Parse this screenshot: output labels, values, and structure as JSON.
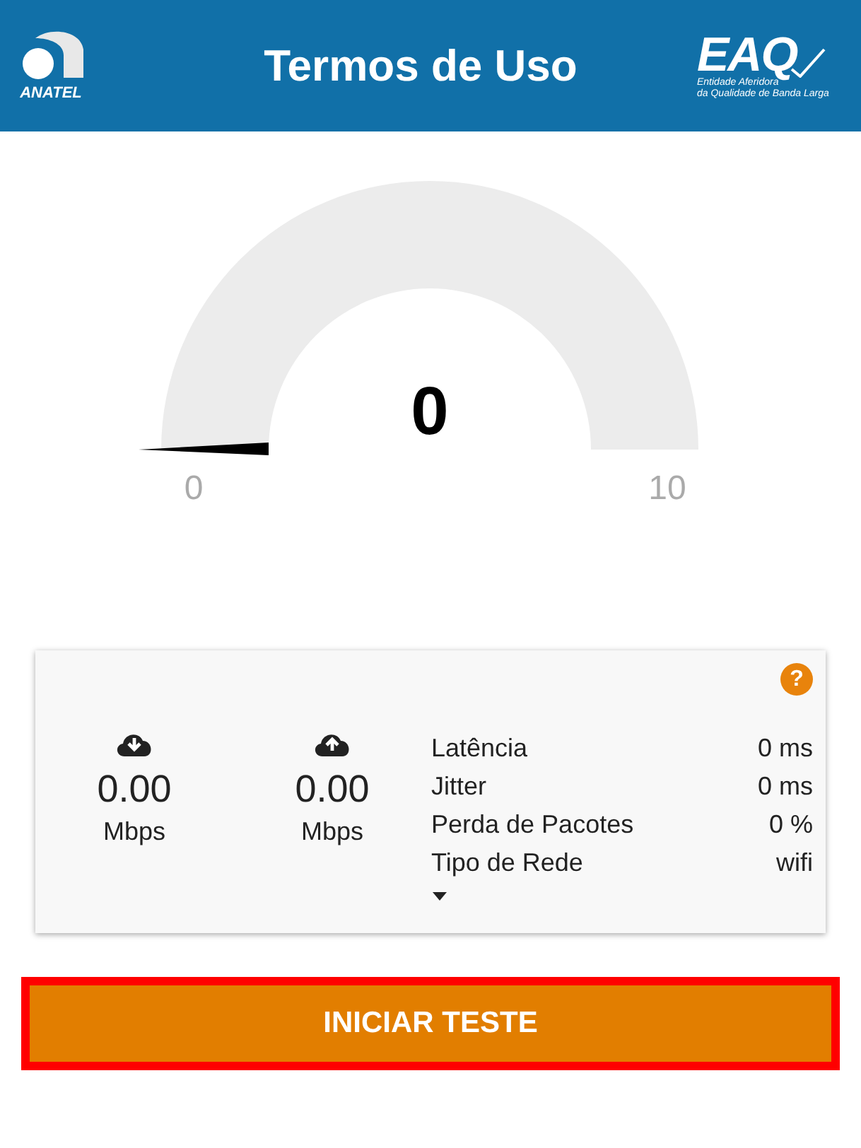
{
  "header": {
    "title": "Termos de Uso",
    "left_logo": "ANATEL",
    "right_logo": {
      "mark": "EAQ",
      "line_1": "Entidade Aferidora",
      "line_2": "da Qualidade de Banda Larga"
    }
  },
  "gauge": {
    "value": "0",
    "min": "0",
    "max": "10"
  },
  "results": {
    "help": "?",
    "speeds": [
      {
        "kind": "download",
        "value": "0.00",
        "unit": "Mbps"
      },
      {
        "kind": "upload",
        "value": "0.00",
        "unit": "Mbps"
      }
    ],
    "stats": [
      {
        "label": "Latência",
        "value": "0 ms"
      },
      {
        "label": "Jitter",
        "value": "0 ms"
      },
      {
        "label": "Perda de Pacotes",
        "value": "0 %"
      },
      {
        "label": "Tipo de Rede",
        "value": "wifi"
      }
    ]
  },
  "start_button": "INICIAR TESTE"
}
